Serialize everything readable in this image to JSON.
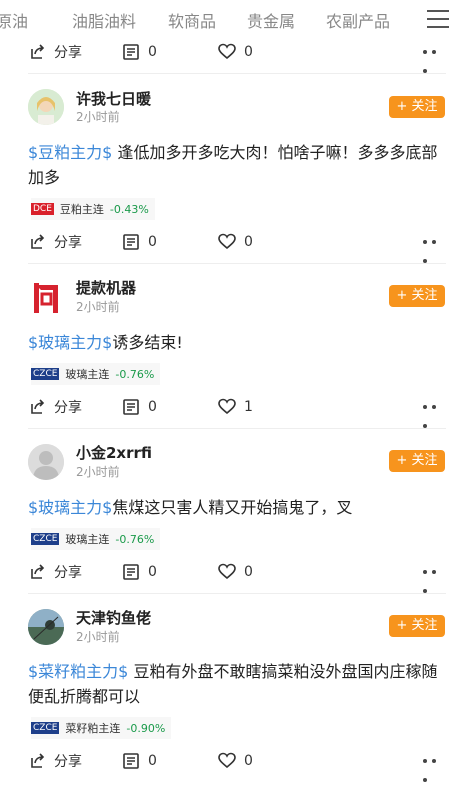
{
  "tabs": [
    "原油",
    "油脂油料",
    "软商品",
    "贵金属",
    "农副产品"
  ],
  "top_actions": {
    "share": "分享",
    "comments": "0",
    "likes": "0"
  },
  "posts": [
    {
      "user": "许我七日暖",
      "time": "2小时前",
      "follow": "+ 关注",
      "tag": "$豆粕主力$",
      "text": " 逢低加多开多吃大肉！怕啥子嘛！多多多底部加多",
      "exchange": "DCE",
      "instrument": "豆粕主连",
      "change": "-0.43%",
      "share": "分享",
      "comments": "0",
      "likes": "0"
    },
    {
      "user": "提款机器",
      "time": "2小时前",
      "follow": "+ 关注",
      "tag": "$玻璃主力$",
      "text": "诱多结束!",
      "exchange": "CZCE",
      "instrument": "玻璃主连",
      "change": "-0.76%",
      "share": "分享",
      "comments": "0",
      "likes": "1"
    },
    {
      "user": "小金2xrrfi",
      "time": "2小时前",
      "follow": "+ 关注",
      "tag": "$玻璃主力$",
      "text": "焦煤这只害人精又开始搞鬼了，叉",
      "exchange": "CZCE",
      "instrument": "玻璃主连",
      "change": "-0.76%",
      "share": "分享",
      "comments": "0",
      "likes": "0"
    },
    {
      "user": "天津钓鱼佬",
      "time": "2小时前",
      "follow": "+ 关注",
      "tag": "$菜籽粕主力$",
      "text": " 豆粕有外盘不敢瞎搞菜粕没外盘国内庄稼随便乱折腾都可以",
      "exchange": "CZCE",
      "instrument": "菜籽粕主连",
      "change": "-0.90%",
      "share": "分享",
      "comments": "0",
      "likes": "0"
    }
  ],
  "colors": {
    "accent": "#f7941d",
    "tag": "#3b87d8",
    "down": "#1a9a4a",
    "dce": "#d9202a",
    "czce": "#1e3f8a"
  }
}
